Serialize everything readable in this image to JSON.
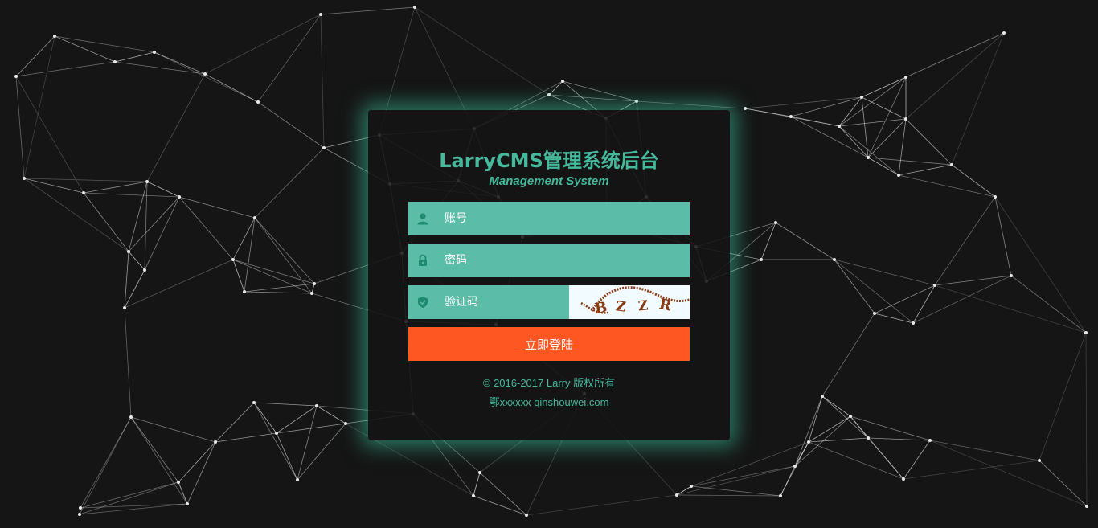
{
  "login": {
    "title": "LarryCMS管理系统后台",
    "subtitle": "Management System",
    "username": {
      "placeholder": "账号",
      "icon": "user-icon"
    },
    "password": {
      "placeholder": "密码",
      "icon": "lock-icon"
    },
    "captcha": {
      "placeholder": "验证码",
      "icon": "shield-icon",
      "image_text": "BZZR"
    },
    "submit_label": "立即登陆"
  },
  "footer": {
    "copyright": "© 2016-2017 Larry 版权所有",
    "icp": "鄂xxxxxx qinshouwei.com"
  },
  "colors": {
    "accent": "#45b99c",
    "field_bg": "#5bbca7",
    "button": "#ff5722",
    "background": "#151515"
  }
}
